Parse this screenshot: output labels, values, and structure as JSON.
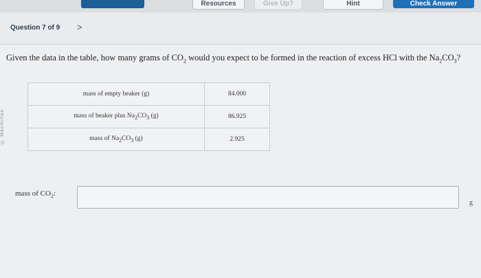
{
  "toolbar": {
    "resources": "Resources",
    "give_up": "Give Up?",
    "hint": "Hint",
    "check_answer": "Check Answer"
  },
  "header": {
    "question_counter": "Question 7 of 9",
    "next_chevron": ">"
  },
  "sidebar_watermark": "© Macmillan",
  "question": {
    "text_parts": [
      "Given the data in the table, how many grams of CO",
      "2",
      " would you expect to be formed in the reaction of excess HCl with the Na",
      "2",
      "CO",
      "3",
      "?"
    ]
  },
  "table": {
    "rows": [
      {
        "label": "mass of empty beaker (g)",
        "value": "84.000"
      },
      {
        "label_parts": [
          "mass of beaker plus Na",
          "2",
          "CO",
          "3",
          " (g)"
        ],
        "value": "86.925"
      },
      {
        "label_parts": [
          "mass of Na",
          "2",
          "CO",
          "3",
          " (g)"
        ],
        "value": "2.925"
      }
    ]
  },
  "answer": {
    "label_parts": [
      "mass of CO",
      "2",
      ":"
    ],
    "value": "",
    "unit": "g"
  }
}
